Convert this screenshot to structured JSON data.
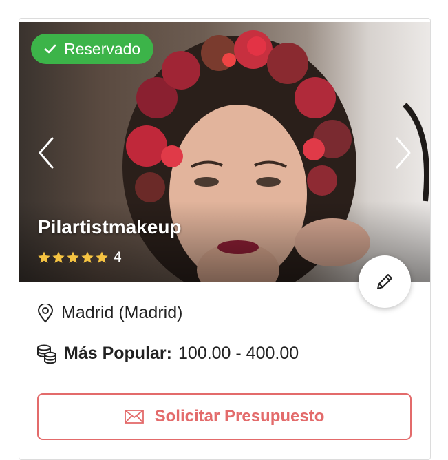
{
  "badge": {
    "label": "Reservado",
    "color": "#3cb449"
  },
  "vendor": {
    "name": "Pilartistmakeup",
    "rating_stars": 5,
    "review_count": "4"
  },
  "location": {
    "text": "Madrid (Madrid)",
    "icon": "location-pin-icon"
  },
  "price": {
    "label": "Más Popular:",
    "value": "100.00 - 400.00",
    "icon": "coins-icon"
  },
  "cta": {
    "label": "Solicitar Presupuesto",
    "icon": "envelope-icon",
    "color": "#e36b6b"
  },
  "icons": [
    "check-icon",
    "chevron-left-icon",
    "chevron-right-icon",
    "star-icon",
    "pencil-icon"
  ]
}
